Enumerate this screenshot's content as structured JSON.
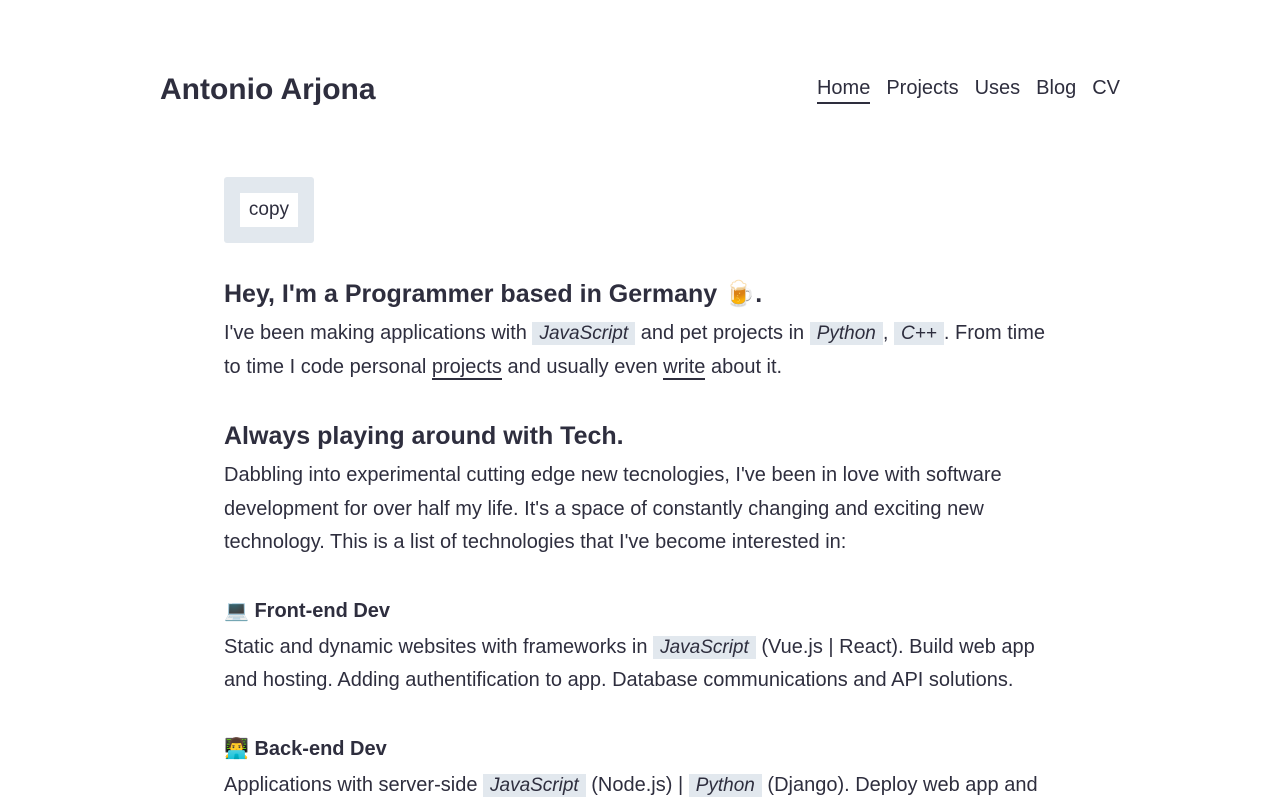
{
  "header": {
    "brand": "Antonio Arjona",
    "nav": [
      "Home",
      "Projects",
      "Uses",
      "Blog",
      "CV"
    ]
  },
  "hero_image_alt": "copy",
  "intro": {
    "heading": "Hey, I'm a Programmer based in Germany",
    "heading_emoji": "🍺",
    "heading_end": ".",
    "p1": "I've been making applications with ",
    "code1": "JavaScript",
    "p2": " and pet projects in ",
    "code2": "Python",
    "p3": ", ",
    "code3": "C++",
    "p4": ". From time to time I code personal ",
    "link1": "projects",
    "p5": " and usually even ",
    "link2": "write",
    "p6": " about it."
  },
  "tech": {
    "heading": "Always playing around with Tech.",
    "text": "Dabbling into experimental cutting edge new tecnologies, I've been in love with software development for over half my life. It's a space of constantly changing and exciting new technology. This is a list of technologies that I've become interested in:"
  },
  "frontend": {
    "emoji": "💻",
    "title": "Front-end Dev",
    "t1": "Static and dynamic websites with frameworks in ",
    "code1": "JavaScript",
    "t2": " (Vue.js | React). Build web app and hosting. Adding authentification to app. Database communications and API solutions."
  },
  "backend": {
    "emoji": "👨‍💻",
    "title": "Back-end Dev",
    "t1": "Applications with server-side ",
    "code1": "JavaScript",
    "t2": " (Node.js) | ",
    "code2": "Python",
    "t3": " (Django). Deploy web app and"
  }
}
